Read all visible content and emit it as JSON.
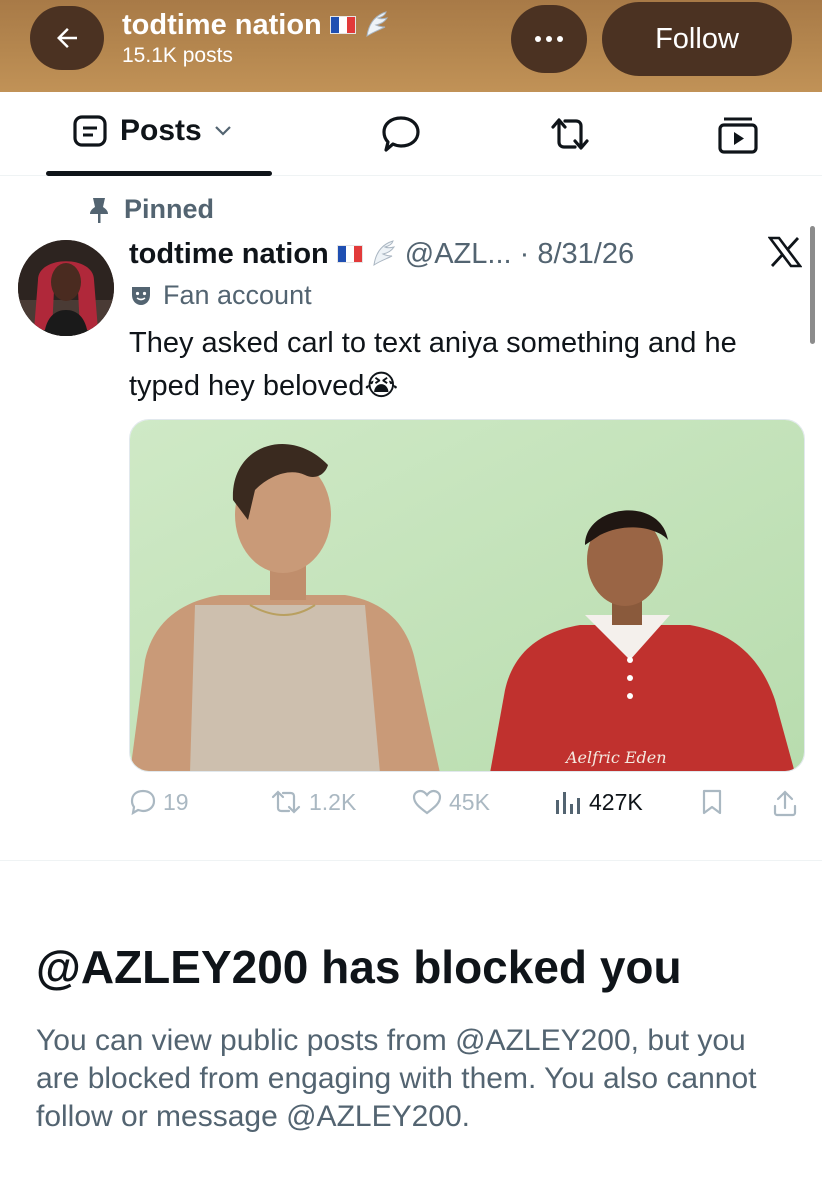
{
  "header": {
    "title": "todtime nation",
    "posts_count": "15.1K posts",
    "follow_label": "Follow",
    "colors": {
      "background": "#b5874f",
      "button": "#4b3222"
    },
    "icons": {
      "back": "back-arrow-icon",
      "more": "more-dots-icon"
    }
  },
  "tabs": {
    "posts_label": "Posts",
    "items": [
      "posts",
      "replies",
      "reposts",
      "media"
    ]
  },
  "post": {
    "pinned_label": "Pinned",
    "author_name": "todtime nation",
    "handle_date": "@AZL... · 8/31/26",
    "badge": "Fan account",
    "text": "They asked carl to text aniya something and he typed hey beloved😭",
    "media_caption": "Aelfric Eden",
    "stats": {
      "replies": "19",
      "reposts": "1.2K",
      "likes": "45K",
      "views": "427K"
    }
  },
  "block_notice": {
    "title": "@AZLEY200 has blocked you",
    "description": "You can view public posts from @AZLEY200, but you are blocked from engaging with them. You also cannot follow or message @AZLEY200."
  }
}
